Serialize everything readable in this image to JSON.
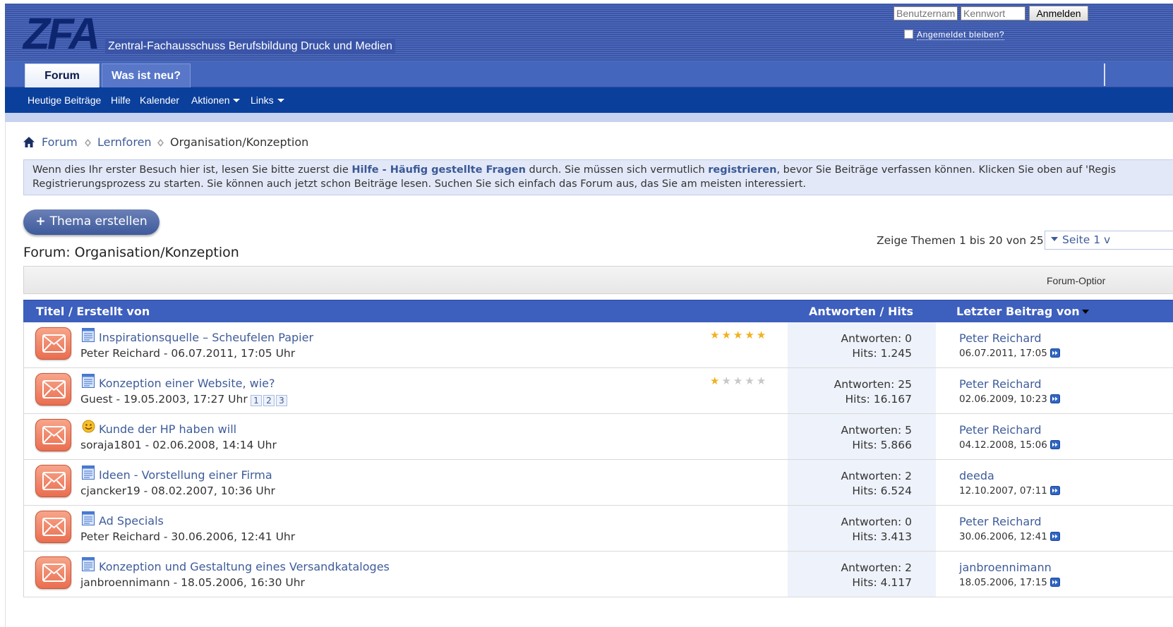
{
  "header": {
    "logo": "ZFA",
    "site_title": "Zentral-Fachausschuss Berufsbildung Druck und Medien",
    "login": {
      "username_placeholder": "Benutzername",
      "password_placeholder": "Kennwort",
      "submit_label": "Anmelden",
      "remember_label": "Angemeldet bleiben?"
    }
  },
  "tabs": [
    {
      "label": "Forum",
      "active": true
    },
    {
      "label": "Was ist neu?",
      "active": false
    }
  ],
  "subnav": [
    {
      "label": "Heutige Beiträge"
    },
    {
      "label": "Hilfe"
    },
    {
      "label": "Kalender"
    },
    {
      "label": "Aktionen",
      "dropdown": true
    },
    {
      "label": "Links",
      "dropdown": true
    }
  ],
  "breadcrumb": {
    "items": [
      "Forum",
      "Lernforen"
    ],
    "current": "Organisation/Konzeption"
  },
  "notice": {
    "l1_a": "Wenn dies Ihr erster Besuch hier ist, lesen Sie bitte zuerst die ",
    "l1_link1": "Hilfe - Häufig gestellte Fragen",
    "l1_b": " durch. Sie müssen sich vermutlich ",
    "l1_link2": "registrieren",
    "l1_c": ", bevor Sie Beiträge verfassen können. Klicken Sie oben auf 'Regis",
    "l2": "Registrierungsprozess zu starten. Sie können auch jetzt schon Beiträge lesen. Suchen Sie sich einfach das Forum aus, das Sie am meisten interessiert."
  },
  "new_thread_label": "Thema erstellen",
  "forum_title": "Forum: Organisation/Konzeption",
  "pagination": {
    "info": "Zeige Themen 1 bis 20 von 25",
    "page_label": "Seite 1 v"
  },
  "forum_options_label": "Forum-Optior",
  "columns": {
    "title": "Titel / Erstellt von",
    "stats": "Antworten / Hits",
    "last": "Letzter Beitrag von"
  },
  "threads": [
    {
      "title": "Inspirationsquelle – Scheufelen Papier",
      "meta": "Peter Reichard - 06.07.2011, 17:05 Uhr",
      "icon": "document-icon",
      "rating": 5,
      "pages": [],
      "replies": "Antworten: 0",
      "hits": "Hits: 1.245",
      "last_user": "Peter Reichard",
      "last_date": "06.07.2011, 17:05"
    },
    {
      "title": "Konzeption einer Website, wie?",
      "meta": "Guest - 19.05.2003, 17:27 Uhr",
      "icon": "document-icon",
      "rating": 1,
      "pages": [
        "1",
        "2",
        "3"
      ],
      "replies": "Antworten: 25",
      "hits": "Hits: 16.167",
      "last_user": "Peter Reichard",
      "last_date": "02.06.2009, 10:23"
    },
    {
      "title": "Kunde der HP haben will",
      "meta": "soraja1801 - 02.06.2008, 14:14 Uhr",
      "icon": "smiley-icon",
      "rating": 0,
      "pages": [],
      "replies": "Antworten: 5",
      "hits": "Hits: 5.866",
      "last_user": "Peter Reichard",
      "last_date": "04.12.2008, 15:06"
    },
    {
      "title": "Ideen - Vorstellung einer Firma",
      "meta": "cjancker19 - 08.02.2007, 10:36 Uhr",
      "icon": "document-icon",
      "rating": 0,
      "pages": [],
      "replies": "Antworten: 2",
      "hits": "Hits: 6.524",
      "last_user": "deeda",
      "last_date": "12.10.2007, 07:11"
    },
    {
      "title": "Ad Specials",
      "meta": "Peter Reichard - 30.06.2006, 12:41 Uhr",
      "icon": "document-icon",
      "rating": 0,
      "pages": [],
      "replies": "Antworten: 0",
      "hits": "Hits: 3.413",
      "last_user": "Peter Reichard",
      "last_date": "30.06.2006, 12:41"
    },
    {
      "title": "Konzeption und Gestaltung eines Versandkataloges",
      "meta": "janbroennimann - 18.05.2006, 16:30 Uhr",
      "icon": "document-icon",
      "rating": 0,
      "pages": [],
      "replies": "Antworten: 2",
      "hits": "Hits: 4.117",
      "last_user": "janbroennimann",
      "last_date": "18.05.2006, 17:15"
    }
  ],
  "colors": {
    "header_blue": "#3a55a8",
    "subnav_blue": "#0a3f9c",
    "table_head": "#3d5fbd",
    "link": "#3e5c9a",
    "star_on": "#f0b21e",
    "star_off": "#c8c8c8"
  }
}
